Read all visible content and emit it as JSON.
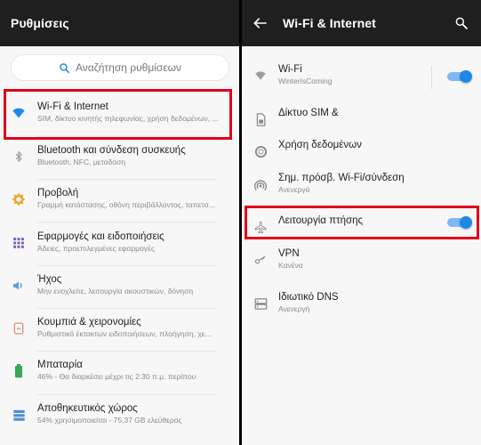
{
  "left": {
    "title": "Ρυθμίσεις",
    "search_placeholder": "Αναζήτηση ρυθμίσεων",
    "items": [
      {
        "title": "Wi-Fi & Internet",
        "subtitle": "SIM, δίκτυο κινητής τηλεφωνίας, χρήση δεδομένων, ..."
      },
      {
        "title": "Bluetooth και σύνδεση συσκευής",
        "subtitle": "Bluetooth, NFC, μεταδοση"
      },
      {
        "title": "Προβολή",
        "subtitle": "Γραμμή κατάστασης, οθόνη περιβάλλοντος, ταπετσ..."
      },
      {
        "title": "Εφαρμογές και ειδοποιήσεις",
        "subtitle": "Άδειες, προεπιλεγμένες εφαρμογές"
      },
      {
        "title": "Ήχος",
        "subtitle": "Μην ενοχλείτε, λειτουργία ακουστικών, δόνηση"
      },
      {
        "title": "Κουμπιά & χειρονομίες",
        "subtitle": "Ρυθμιστικό έκτακτων ειδοποιήσεων, πλοήγηση, χε..."
      },
      {
        "title": "Μπαταρία",
        "subtitle": "46% - Θα διαρκέσει μέχρι τις 2:30 π.μ. περίπου"
      },
      {
        "title": "Αποθηκευτικός χώρος",
        "subtitle": "54% χρησιμοποιείται - 75,37 GB ελεύθερος"
      }
    ]
  },
  "right": {
    "title": "Wi-Fi & Internet",
    "items": [
      {
        "title": "Wi-Fi",
        "subtitle": "WinterIsComing",
        "toggle": true
      },
      {
        "title": "Δίκτυο SIM &",
        "subtitle": ""
      },
      {
        "title": "Χρήση δεδομένων",
        "subtitle": ""
      },
      {
        "title": "Σημ. πρόσβ. Wi-Fi/σύνδεση",
        "subtitle": "Ανενεργό"
      },
      {
        "title": "Λειτουργία πτήσης",
        "subtitle": "",
        "toggle": true
      },
      {
        "title": "VPN",
        "subtitle": "Κανένα"
      },
      {
        "title": "Ιδιωτικό DNS",
        "subtitle": "Ανενεργή"
      }
    ]
  },
  "colors": {
    "accent": "#1e88e5",
    "highlight": "#e0001b",
    "topbar": "#1f1f1f",
    "background": "#f7f7f7"
  },
  "icons": [
    "search-icon",
    "wifi-icon",
    "bluetooth-icon",
    "brightness-icon",
    "apps-icon",
    "volume-icon",
    "gesture-icon",
    "battery-icon",
    "storage-icon",
    "back-arrow-icon",
    "sim-icon",
    "data-usage-icon",
    "hotspot-icon",
    "airplane-icon",
    "vpn-key-icon",
    "dns-icon"
  ]
}
